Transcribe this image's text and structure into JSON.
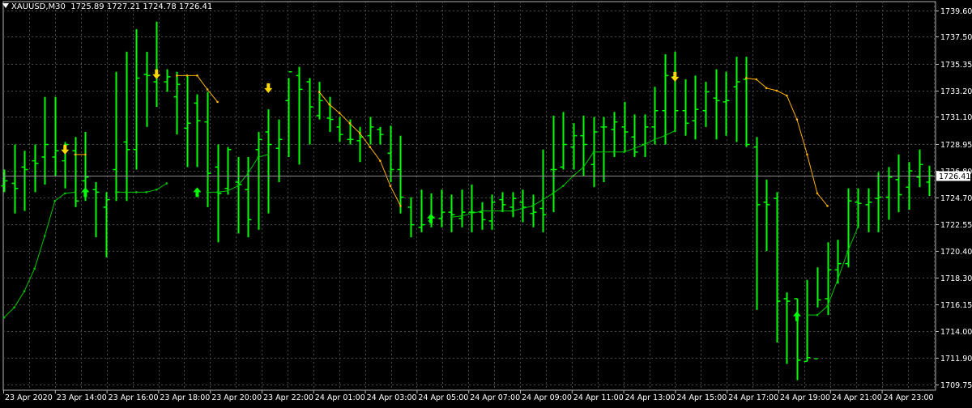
{
  "header": {
    "symbol": "XAUUSD,M30",
    "ohlc": "1725.89 1727.21 1724.78 1726.41"
  },
  "colors": {
    "background": "#000000",
    "grid": "#4a4a4a",
    "bars": "#00ff00",
    "up_line": "#00c800",
    "down_line": "#ffb400",
    "arrow_up": "#00ff00",
    "arrow_down": "#ffd700",
    "axis_text": "#ffffff"
  },
  "chart_data": {
    "type": "ohlc",
    "symbol": "XAUUSD",
    "timeframe": "M30",
    "current_price": "1726.41",
    "y_tick_labels": [
      "1739.60",
      "1737.50",
      "1735.35",
      "1733.20",
      "1731.10",
      "1728.95",
      "1726.80",
      "1724.70",
      "1722.55",
      "1720.40",
      "1718.30",
      "1716.15",
      "1714.00",
      "1711.90",
      "1709.75"
    ],
    "x_tick_labels": [
      "23 Apr 2020",
      "23 Apr 14:00",
      "23 Apr 16:00",
      "23 Apr 18:00",
      "23 Apr 20:00",
      "23 Apr 22:00",
      "24 Apr 01:00",
      "24 Apr 03:00",
      "24 Apr 05:00",
      "24 Apr 07:00",
      "24 Apr 09:00",
      "24 Apr 11:00",
      "24 Apr 13:00",
      "24 Apr 15:00",
      "24 Apr 17:00",
      "24 Apr 19:00",
      "24 Apr 21:00",
      "24 Apr 23:00"
    ],
    "ylim": [
      1709.3,
      1740.3
    ],
    "grid": true,
    "bars": [
      {
        "o": 1725.6,
        "h": 1726.9,
        "l": 1725.1,
        "c": 1726.0
      },
      {
        "o": 1725.8,
        "h": 1728.9,
        "l": 1723.4,
        "c": 1725.4
      },
      {
        "o": 1727.1,
        "h": 1728.4,
        "l": 1723.6,
        "c": 1726.9
      },
      {
        "o": 1727.6,
        "h": 1728.9,
        "l": 1725.1,
        "c": 1727.4
      },
      {
        "o": 1727.9,
        "h": 1732.7,
        "l": 1725.7,
        "c": 1728.9
      },
      {
        "o": 1727.9,
        "h": 1732.7,
        "l": 1726.4,
        "c": 1728.4
      },
      {
        "o": 1727.6,
        "h": 1729.1,
        "l": 1725.4,
        "c": 1728.9
      },
      {
        "o": 1728.4,
        "h": 1729.5,
        "l": 1723.9,
        "c": 1724.4
      },
      {
        "o": 1726.0,
        "h": 1729.9,
        "l": 1724.4,
        "c": 1726.3
      },
      {
        "o": 1725.3,
        "h": 1725.9,
        "l": 1721.5,
        "c": 1725.1
      },
      {
        "o": 1723.9,
        "h": 1725.1,
        "l": 1719.9,
        "c": 1724.5
      },
      {
        "o": 1726.9,
        "h": 1734.7,
        "l": 1724.4,
        "c": 1725.1
      },
      {
        "o": 1729.1,
        "h": 1736.3,
        "l": 1724.4,
        "c": 1728.5
      },
      {
        "o": 1728.5,
        "h": 1738.1,
        "l": 1726.9,
        "c": 1734.2
      },
      {
        "o": 1734.5,
        "h": 1736.3,
        "l": 1730.3,
        "c": 1734.4
      },
      {
        "o": 1733.9,
        "h": 1738.7,
        "l": 1731.9,
        "c": 1734.4
      },
      {
        "o": 1733.9,
        "h": 1734.9,
        "l": 1733.1,
        "c": 1734.3
      },
      {
        "o": 1732.7,
        "h": 1734.7,
        "l": 1729.7,
        "c": 1733.7
      },
      {
        "o": 1730.2,
        "h": 1734.4,
        "l": 1727.1,
        "c": 1730.6
      },
      {
        "o": 1732.2,
        "h": 1732.9,
        "l": 1727.1,
        "c": 1730.8
      },
      {
        "o": 1730.7,
        "h": 1733.1,
        "l": 1723.9,
        "c": 1726.6
      },
      {
        "o": 1727.1,
        "h": 1728.9,
        "l": 1721.1,
        "c": 1725.0
      },
      {
        "o": 1725.4,
        "h": 1728.7,
        "l": 1724.9,
        "c": 1728.5
      },
      {
        "o": 1725.9,
        "h": 1727.9,
        "l": 1721.8,
        "c": 1725.7
      },
      {
        "o": 1725.3,
        "h": 1727.9,
        "l": 1721.5,
        "c": 1722.9
      },
      {
        "o": 1728.5,
        "h": 1729.9,
        "l": 1722.1,
        "c": 1729.3
      },
      {
        "o": 1729.9,
        "h": 1731.7,
        "l": 1723.4,
        "c": 1728.9
      },
      {
        "o": 1728.6,
        "h": 1730.9,
        "l": 1725.9,
        "c": 1729.3
      },
      {
        "o": 1732.4,
        "h": 1734.2,
        "l": 1727.9,
        "c": 1734.7
      },
      {
        "o": 1734.4,
        "h": 1735.1,
        "l": 1727.3,
        "c": 1733.3
      },
      {
        "o": 1733.9,
        "h": 1734.2,
        "l": 1728.9,
        "c": 1731.9
      },
      {
        "o": 1731.2,
        "h": 1733.9,
        "l": 1730.9,
        "c": 1732.4
      },
      {
        "o": 1731.0,
        "h": 1732.7,
        "l": 1729.9,
        "c": 1730.9
      },
      {
        "o": 1730.3,
        "h": 1731.1,
        "l": 1729.1,
        "c": 1729.7
      },
      {
        "o": 1729.3,
        "h": 1730.9,
        "l": 1728.9,
        "c": 1729.3
      },
      {
        "o": 1729.2,
        "h": 1730.3,
        "l": 1727.5,
        "c": 1729.5
      },
      {
        "o": 1729.6,
        "h": 1731.1,
        "l": 1728.9,
        "c": 1730.3
      },
      {
        "o": 1730.1,
        "h": 1730.3,
        "l": 1728.9,
        "c": 1729.7
      },
      {
        "o": 1728.2,
        "h": 1730.4,
        "l": 1725.9,
        "c": 1726.9
      },
      {
        "o": 1726.9,
        "h": 1729.6,
        "l": 1723.4,
        "c": 1724.7
      },
      {
        "o": 1723.9,
        "h": 1724.7,
        "l": 1721.5,
        "c": 1722.5
      },
      {
        "o": 1722.3,
        "h": 1725.3,
        "l": 1721.9,
        "c": 1722.5
      },
      {
        "o": 1722.8,
        "h": 1725.0,
        "l": 1722.3,
        "c": 1723.1
      },
      {
        "o": 1723.0,
        "h": 1725.3,
        "l": 1722.3,
        "c": 1723.5
      },
      {
        "o": 1723.5,
        "h": 1724.9,
        "l": 1721.9,
        "c": 1723.3
      },
      {
        "o": 1723.0,
        "h": 1725.3,
        "l": 1722.3,
        "c": 1723.5
      },
      {
        "o": 1723.5,
        "h": 1725.7,
        "l": 1721.9,
        "c": 1723.5
      },
      {
        "o": 1723.5,
        "h": 1724.3,
        "l": 1722.1,
        "c": 1722.9
      },
      {
        "o": 1722.8,
        "h": 1724.9,
        "l": 1722.1,
        "c": 1724.3
      },
      {
        "o": 1724.5,
        "h": 1725.1,
        "l": 1723.5,
        "c": 1724.1
      },
      {
        "o": 1723.9,
        "h": 1725.1,
        "l": 1723.1,
        "c": 1724.6
      },
      {
        "o": 1724.3,
        "h": 1725.3,
        "l": 1722.7,
        "c": 1723.9
      },
      {
        "o": 1723.4,
        "h": 1724.9,
        "l": 1722.3,
        "c": 1723.5
      },
      {
        "o": 1723.8,
        "h": 1728.5,
        "l": 1721.9,
        "c": 1723.3
      },
      {
        "o": 1726.9,
        "h": 1731.2,
        "l": 1723.5,
        "c": 1726.9
      },
      {
        "o": 1727.1,
        "h": 1731.5,
        "l": 1726.9,
        "c": 1728.9
      },
      {
        "o": 1728.7,
        "h": 1730.6,
        "l": 1726.9,
        "c": 1729.6
      },
      {
        "o": 1729.6,
        "h": 1731.2,
        "l": 1726.4,
        "c": 1728.9
      },
      {
        "o": 1727.3,
        "h": 1731.1,
        "l": 1725.5,
        "c": 1729.9
      },
      {
        "o": 1730.3,
        "h": 1731.1,
        "l": 1725.9,
        "c": 1730.3
      },
      {
        "o": 1730.1,
        "h": 1731.5,
        "l": 1727.9,
        "c": 1730.7
      },
      {
        "o": 1730.3,
        "h": 1732.3,
        "l": 1728.3,
        "c": 1729.9
      },
      {
        "o": 1729.5,
        "h": 1731.3,
        "l": 1727.9,
        "c": 1728.3
      },
      {
        "o": 1728.9,
        "h": 1731.3,
        "l": 1727.9,
        "c": 1730.3
      },
      {
        "o": 1730.3,
        "h": 1733.5,
        "l": 1728.9,
        "c": 1731.6
      },
      {
        "o": 1731.6,
        "h": 1736.1,
        "l": 1728.9,
        "c": 1734.4
      },
      {
        "o": 1734.3,
        "h": 1736.3,
        "l": 1729.9,
        "c": 1731.6
      },
      {
        "o": 1731.6,
        "h": 1734.1,
        "l": 1729.6,
        "c": 1730.6
      },
      {
        "o": 1730.8,
        "h": 1734.4,
        "l": 1729.3,
        "c": 1731.7
      },
      {
        "o": 1731.6,
        "h": 1733.9,
        "l": 1730.3,
        "c": 1733.1
      },
      {
        "o": 1732.6,
        "h": 1734.9,
        "l": 1729.3,
        "c": 1732.4
      },
      {
        "o": 1732.3,
        "h": 1734.7,
        "l": 1729.6,
        "c": 1732.4
      },
      {
        "o": 1733.5,
        "h": 1735.9,
        "l": 1729.1,
        "c": 1733.9
      },
      {
        "o": 1734.1,
        "h": 1735.9,
        "l": 1728.7,
        "c": 1728.9
      },
      {
        "o": 1728.7,
        "h": 1729.5,
        "l": 1715.7,
        "c": 1724.1
      },
      {
        "o": 1724.3,
        "h": 1726.1,
        "l": 1720.4,
        "c": 1724.1
      },
      {
        "o": 1724.6,
        "h": 1725.1,
        "l": 1713.1,
        "c": 1716.4
      },
      {
        "o": 1716.6,
        "h": 1717.1,
        "l": 1711.4,
        "c": 1716.4
      },
      {
        "o": 1716.6,
        "h": 1716.6,
        "l": 1710.1,
        "c": 1711.7
      },
      {
        "o": 1711.6,
        "h": 1718.1,
        "l": 1711.6,
        "c": 1711.9
      },
      {
        "o": 1711.8,
        "h": 1719.1,
        "l": 1715.9,
        "c": 1716.5
      },
      {
        "o": 1716.6,
        "h": 1721.1,
        "l": 1715.3,
        "c": 1718.9
      },
      {
        "o": 1718.9,
        "h": 1721.3,
        "l": 1717.8,
        "c": 1719.4
      },
      {
        "o": 1719.4,
        "h": 1725.4,
        "l": 1719.1,
        "c": 1724.4
      },
      {
        "o": 1724.3,
        "h": 1725.4,
        "l": 1722.3,
        "c": 1724.2
      },
      {
        "o": 1724.1,
        "h": 1725.4,
        "l": 1721.9,
        "c": 1724.3
      },
      {
        "o": 1724.6,
        "h": 1726.7,
        "l": 1721.9,
        "c": 1724.7
      },
      {
        "o": 1724.7,
        "h": 1727.1,
        "l": 1722.9,
        "c": 1726.3
      },
      {
        "o": 1726.1,
        "h": 1728.1,
        "l": 1723.5,
        "c": 1724.9
      },
      {
        "o": 1725.5,
        "h": 1727.5,
        "l": 1723.7,
        "c": 1726.8
      },
      {
        "o": 1726.3,
        "h": 1728.5,
        "l": 1725.5,
        "c": 1727.3
      },
      {
        "o": 1725.9,
        "h": 1727.2,
        "l": 1724.8,
        "c": 1726.4
      }
    ],
    "up_line_segments": [
      [
        [
          0,
          1715.1
        ],
        [
          1,
          1715.9
        ],
        [
          2,
          1717.2
        ],
        [
          3,
          1719.0
        ],
        [
          4,
          1721.6
        ],
        [
          5,
          1724.4
        ],
        [
          6,
          1725.0
        ],
        [
          7,
          1725.1
        ]
      ],
      [
        [
          11,
          1725.1
        ],
        [
          12,
          1725.1
        ],
        [
          13,
          1725.1
        ],
        [
          14,
          1725.1
        ],
        [
          15,
          1725.3
        ],
        [
          16,
          1725.8
        ]
      ],
      [
        [
          20,
          1725.1
        ],
        [
          21,
          1725.1
        ],
        [
          22,
          1725.2
        ],
        [
          23,
          1725.6
        ],
        [
          24,
          1726.6
        ],
        [
          25,
          1727.9
        ],
        [
          26,
          1728.1
        ]
      ],
      [
        [
          44,
          1723.1
        ],
        [
          45,
          1723.2
        ],
        [
          46,
          1723.4
        ],
        [
          47,
          1723.6
        ],
        [
          48,
          1723.6
        ],
        [
          49,
          1723.6
        ],
        [
          50,
          1723.6
        ],
        [
          51,
          1723.8
        ],
        [
          52,
          1724.0
        ],
        [
          53,
          1724.5
        ],
        [
          54,
          1725.0
        ],
        [
          55,
          1725.6
        ],
        [
          56,
          1726.4
        ],
        [
          57,
          1727.1
        ],
        [
          58,
          1728.3
        ],
        [
          59,
          1728.3
        ],
        [
          60,
          1728.3
        ],
        [
          61,
          1728.3
        ],
        [
          62,
          1728.6
        ],
        [
          63,
          1728.9
        ],
        [
          64,
          1729.3
        ],
        [
          65,
          1729.6
        ],
        [
          66,
          1730.0
        ]
      ],
      [
        [
          79,
          1715.3
        ],
        [
          80,
          1715.3
        ],
        [
          81,
          1716.0
        ],
        [
          82,
          1718.1
        ],
        [
          83,
          1720.4
        ],
        [
          84,
          1722.3
        ]
      ]
    ],
    "down_line_segments": [
      [
        [
          7,
          1728.1
        ],
        [
          8,
          1728.1
        ]
      ],
      [
        [
          17,
          1734.4
        ],
        [
          18,
          1734.4
        ],
        [
          19,
          1734.4
        ],
        [
          20,
          1733.3
        ],
        [
          21,
          1732.3
        ]
      ],
      [
        [
          31,
          1733.1
        ],
        [
          32,
          1732.1
        ],
        [
          33,
          1731.4
        ],
        [
          34,
          1730.6
        ],
        [
          35,
          1729.8
        ],
        [
          36,
          1728.7
        ],
        [
          37,
          1727.6
        ],
        [
          38,
          1725.6
        ],
        [
          39,
          1724.0
        ]
      ],
      [
        [
          73,
          1734.2
        ],
        [
          74,
          1734.1
        ],
        [
          75,
          1733.4
        ],
        [
          76,
          1733.2
        ],
        [
          77,
          1732.8
        ],
        [
          78,
          1730.9
        ],
        [
          79,
          1728.1
        ],
        [
          80,
          1725.0
        ],
        [
          81,
          1724.0
        ]
      ]
    ],
    "buy_arrows": [
      [
        8,
        1725.1
      ],
      [
        19,
        1725.1
      ],
      [
        42,
        1723.0
      ],
      [
        78,
        1715.2
      ]
    ],
    "sell_arrows": [
      [
        6,
        1728.5
      ],
      [
        15,
        1734.5
      ],
      [
        26,
        1733.4
      ],
      [
        66,
        1734.3
      ]
    ]
  }
}
